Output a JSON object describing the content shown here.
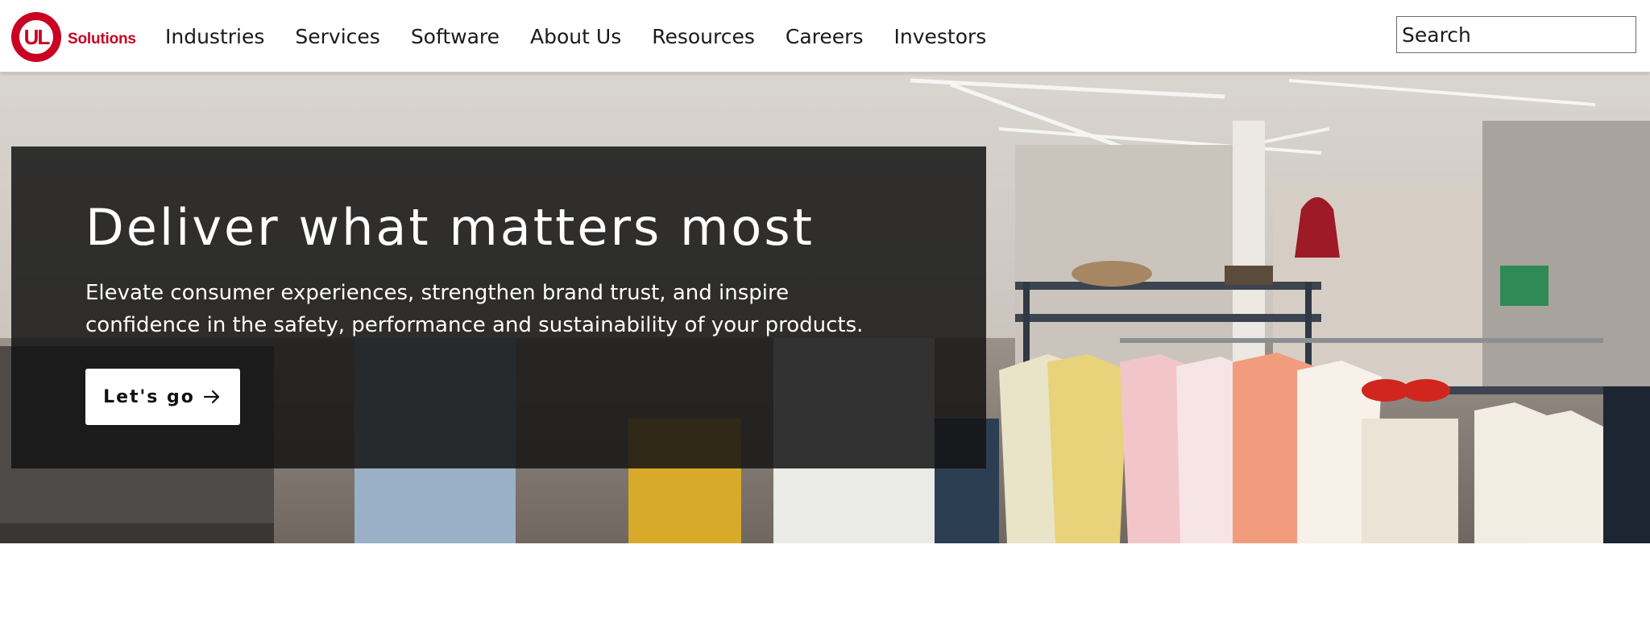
{
  "brand": {
    "logo_mark": "UL",
    "logo_text": "Solutions",
    "color": "#ca0123"
  },
  "nav": {
    "items": [
      {
        "label": "Industries"
      },
      {
        "label": "Services"
      },
      {
        "label": "Software"
      },
      {
        "label": "About Us"
      },
      {
        "label": "Resources"
      },
      {
        "label": "Careers"
      },
      {
        "label": "Investors"
      }
    ]
  },
  "search": {
    "placeholder": "Search",
    "icon": "search-icon"
  },
  "hero": {
    "title": "Deliver what matters most",
    "description": "Elevate consumer experiences, strengthen brand trust, and inspire confidence in the safety, performance and sustainability of your products.",
    "cta_label": "Let's go",
    "cta_icon": "arrow-right-icon",
    "panel_color": "#141414",
    "background_image": "retail-clothing-store"
  }
}
